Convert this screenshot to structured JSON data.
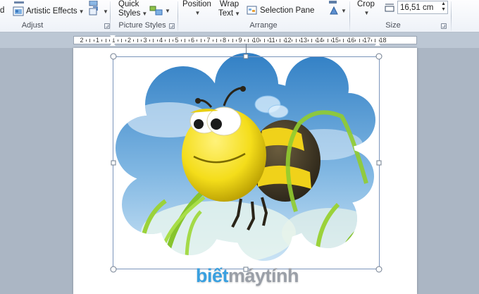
{
  "ribbon": {
    "adjust": {
      "artistic_effects": "Artistic Effects",
      "group_label": "Adjust",
      "cut_off_char": "d"
    },
    "picture_styles": {
      "quick_styles": "Quick Styles",
      "group_label": "Picture Styles"
    },
    "arrange": {
      "position": "Position",
      "wrap_text": "Wrap Text",
      "selection_pane": "Selection Pane",
      "group_label": "Arrange"
    },
    "size": {
      "crop": "Crop",
      "width_value": "16,51 cm",
      "group_label": "Size"
    }
  },
  "ruler": {
    "labels": [
      "2",
      "1",
      "1",
      "2",
      "3",
      "4",
      "5",
      "6",
      "7",
      "8",
      "9",
      "10",
      "11",
      "12",
      "13",
      "14",
      "15",
      "16",
      "17",
      "18"
    ]
  },
  "watermark": {
    "part1": "biết",
    "part2": "máytính"
  },
  "colors": {
    "ribbon_bg": "#eef2f8",
    "app_bg": "#abb6c4",
    "sky_top": "#2f7ec4",
    "sky_bottom": "#cfe6f6",
    "bee_yellow": "#f4dd1a",
    "bee_dark": "#3a3324",
    "grass": "#8ccf2e",
    "watermark_blue": "#39a0e0",
    "watermark_grey": "#9a9fa7"
  }
}
